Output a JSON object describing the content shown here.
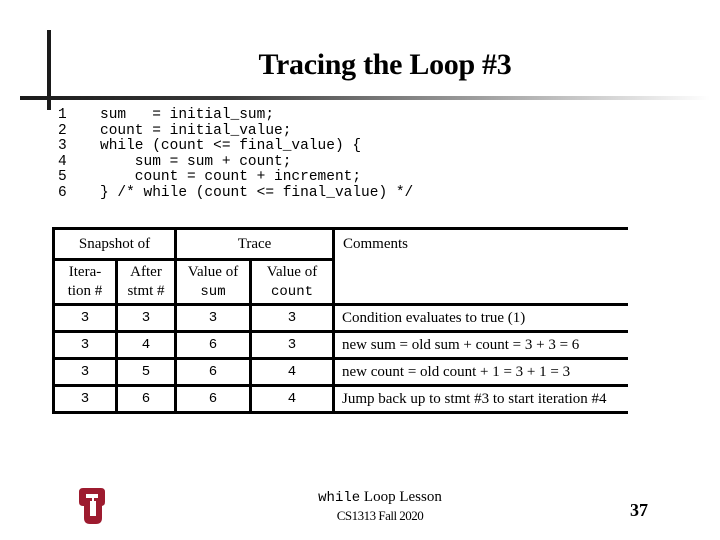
{
  "slide": {
    "title": "Tracing the Loop #3",
    "page_number": "37"
  },
  "code": {
    "lines": [
      {
        "num": "1",
        "text": "sum   = initial_sum;"
      },
      {
        "num": "2",
        "text": "count = initial_value;"
      },
      {
        "num": "3",
        "text": "while (count <= final_value) {"
      },
      {
        "num": "4",
        "text": "    sum = sum + count;"
      },
      {
        "num": "5",
        "text": "    count = count + increment;"
      },
      {
        "num": "6",
        "text": "} /* while (count <= final_value) */"
      }
    ]
  },
  "trace_table": {
    "group_headers": {
      "snapshot": "Snapshot of",
      "trace": "Trace",
      "comments": "Comments"
    },
    "sub_headers": {
      "iteration_line1": "Itera-",
      "iteration_line2": "tion #",
      "stmt_line1": "After",
      "stmt_line2": "stmt #",
      "sum_line1": "Value of",
      "sum_line2": "sum",
      "count_line1": "Value of",
      "count_line2": "count"
    },
    "rows": [
      {
        "iteration": "3",
        "stmt": "3",
        "sum": "3",
        "count": "3",
        "comment": "Condition evaluates to true (1)"
      },
      {
        "iteration": "3",
        "stmt": "4",
        "sum": "6",
        "count": "3",
        "comment": "new sum = old sum + count = 3 + 3 = 6"
      },
      {
        "iteration": "3",
        "stmt": "5",
        "sum": "6",
        "count": "4",
        "comment": "new count = old count + 1 = 3 + 1 = 3"
      },
      {
        "iteration": "3",
        "stmt": "6",
        "sum": "6",
        "count": "4",
        "comment": "Jump back up to stmt #3 to start iteration #4"
      }
    ]
  },
  "footer": {
    "lesson_keyword": "while",
    "lesson_rest": " Loop Lesson",
    "course": "CS1313 Fall 2020",
    "logo_text": "OU",
    "logo_color": "#9d1b2f"
  }
}
